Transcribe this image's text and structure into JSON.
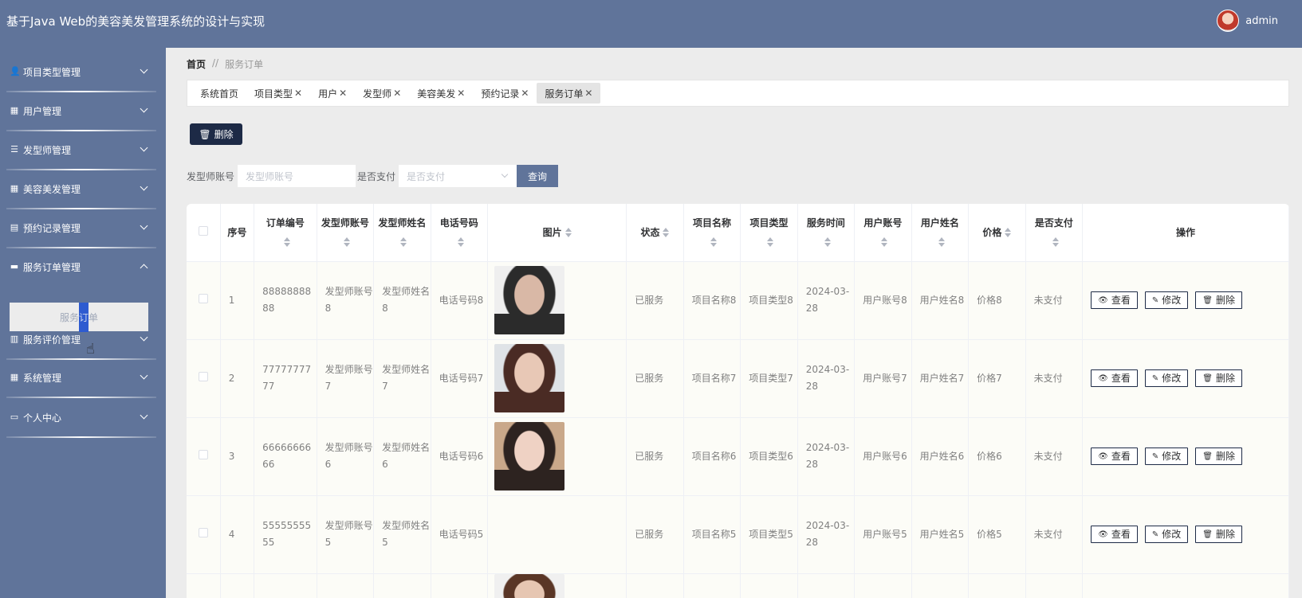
{
  "app_title": "基于Java Web的美容美发管理系统的设计与实现",
  "user": {
    "name": "admin"
  },
  "sidebar": {
    "items": [
      {
        "label": "项目类型管理",
        "icon": "person-icon"
      },
      {
        "label": "用户管理",
        "icon": "grid-icon"
      },
      {
        "label": "发型师管理",
        "icon": "list-icon"
      },
      {
        "label": "美容美发管理",
        "icon": "grid-icon"
      },
      {
        "label": "预约记录管理",
        "icon": "briefcase-icon"
      },
      {
        "label": "服务订单管理",
        "icon": "ticket-icon",
        "expanded": true
      },
      {
        "label": "服务评价管理",
        "icon": "book-icon"
      },
      {
        "label": "系统管理",
        "icon": "grid-icon"
      },
      {
        "label": "个人中心",
        "icon": "card-icon"
      }
    ],
    "submenu_label_pre": "服务",
    "submenu_label_sel": "订",
    "submenu_label_post": "单"
  },
  "breadcrumb": {
    "home": "首页",
    "separator": "//",
    "current": "服务订单"
  },
  "tabs": [
    {
      "label": "系统首页",
      "closable": false
    },
    {
      "label": "项目类型",
      "closable": true
    },
    {
      "label": "用户",
      "closable": true
    },
    {
      "label": "发型师",
      "closable": true
    },
    {
      "label": "美容美发",
      "closable": true
    },
    {
      "label": "预约记录",
      "closable": true
    },
    {
      "label": "服务订单",
      "closable": true,
      "active": true
    }
  ],
  "toolbar": {
    "delete_label": "删除"
  },
  "search": {
    "stylist_label": "发型师账号",
    "stylist_placeholder": "发型师账号",
    "paid_label": "是否支付",
    "paid_placeholder": "是否支付",
    "query_label": "查询"
  },
  "table": {
    "headers": {
      "seq": "序号",
      "order_no": "订单编号",
      "stylist_account": "发型师账号",
      "stylist_name": "发型师姓名",
      "phone": "电话号码",
      "image": "图片",
      "status": "状态",
      "item_name": "项目名称",
      "item_type": "项目类型",
      "service_time": "服务时间",
      "user_account": "用户账号",
      "user_name": "用户姓名",
      "price": "价格",
      "paid": "是否支付",
      "actions": "操作"
    },
    "actions": {
      "view": "查看",
      "edit": "修改",
      "delete": "删除"
    },
    "rows": [
      {
        "seq": "1",
        "order_no": "8888888888",
        "stylist_account": "发型师账号8",
        "stylist_name": "发型师姓名8",
        "phone": "电话号码8",
        "has_image": true,
        "status": "已服务",
        "item_name": "项目名称8",
        "item_type": "项目类型8",
        "service_time": "2024-03-28",
        "user_account": "用户账号8",
        "user_name": "用户姓名8",
        "price": "价格8",
        "paid": "未支付",
        "image_colors": [
          "#2b2b2b",
          "#d9b8a6",
          "#efefef"
        ]
      },
      {
        "seq": "2",
        "order_no": "7777777777",
        "stylist_account": "发型师账号7",
        "stylist_name": "发型师姓名7",
        "phone": "电话号码7",
        "has_image": true,
        "status": "已服务",
        "item_name": "项目名称7",
        "item_type": "项目类型7",
        "service_time": "2024-03-28",
        "user_account": "用户账号7",
        "user_name": "用户姓名7",
        "price": "价格7",
        "paid": "未支付",
        "image_colors": [
          "#4a2b24",
          "#e8c8b6",
          "#dfe3e7"
        ]
      },
      {
        "seq": "3",
        "order_no": "6666666666",
        "stylist_account": "发型师账号6",
        "stylist_name": "发型师姓名6",
        "phone": "电话号码6",
        "has_image": true,
        "status": "已服务",
        "item_name": "项目名称6",
        "item_type": "项目类型6",
        "service_time": "2024-03-28",
        "user_account": "用户账号6",
        "user_name": "用户姓名6",
        "price": "价格6",
        "paid": "未支付",
        "image_colors": [
          "#2d2320",
          "#efd2c4",
          "#c9a88a"
        ]
      },
      {
        "seq": "4",
        "order_no": "5555555555",
        "stylist_account": "发型师账号5",
        "stylist_name": "发型师姓名5",
        "phone": "电话号码5",
        "has_image": false,
        "status": "已服务",
        "item_name": "项目名称5",
        "item_type": "项目类型5",
        "service_time": "2024-03-28",
        "user_account": "用户账号5",
        "user_name": "用户姓名5",
        "price": "价格5",
        "paid": "未支付",
        "image_colors": []
      },
      {
        "seq": "",
        "order_no": "",
        "stylist_account": "",
        "stylist_name": "",
        "phone": "",
        "has_image": true,
        "status": "",
        "item_name": "",
        "item_type": "",
        "service_time": "",
        "user_account": "",
        "user_name": "",
        "price": "",
        "paid": "",
        "partial": true,
        "image_colors": [
          "#5a3626",
          "#e6c6b2",
          "#f0f0f0"
        ]
      }
    ]
  },
  "colors": {
    "brand": "#60749a",
    "dark_button": "#1d2a46",
    "page_bg": "#ececec",
    "table_bg": "#fcfcf7"
  }
}
